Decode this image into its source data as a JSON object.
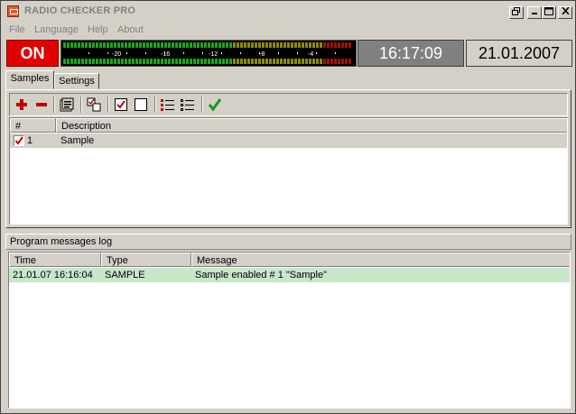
{
  "window": {
    "title": "RADIO CHECKER PRO",
    "buttons": {
      "restore": "⧉",
      "minimize": "_",
      "maximize": "□",
      "close": "×"
    }
  },
  "menu": [
    "File",
    "Language",
    "Help",
    "About"
  ],
  "status": {
    "on_label": "ON",
    "meter_ticks": [
      "-20",
      "-16",
      "-12",
      "-8",
      "-4"
    ],
    "time": "16:17:09",
    "date": "21.01.2007",
    "colors": {
      "on_bg": "#e30000",
      "meter_green": "#19a619",
      "meter_yellow": "#8c8c00",
      "meter_red": "#a01010"
    }
  },
  "tabs": [
    "Samples",
    "Settings"
  ],
  "toolbar": {
    "icons": [
      "add-icon",
      "remove-icon",
      "properties-icon",
      "toggle-icon",
      "check-all-icon",
      "uncheck-all-icon",
      "list-all-icon",
      "list-selected-icon",
      "apply-icon"
    ]
  },
  "samples": {
    "columns": [
      "#",
      "Description"
    ],
    "rows": [
      {
        "checked": true,
        "number": "1",
        "description": "Sample"
      }
    ]
  },
  "log": {
    "label": "Program messages log",
    "columns": [
      "Time",
      "Type",
      "Message"
    ],
    "rows": [
      {
        "time": "21.01.07 16:16:04",
        "type": "SAMPLE",
        "message": "Sample enabled # 1 \"Sample\""
      }
    ]
  }
}
